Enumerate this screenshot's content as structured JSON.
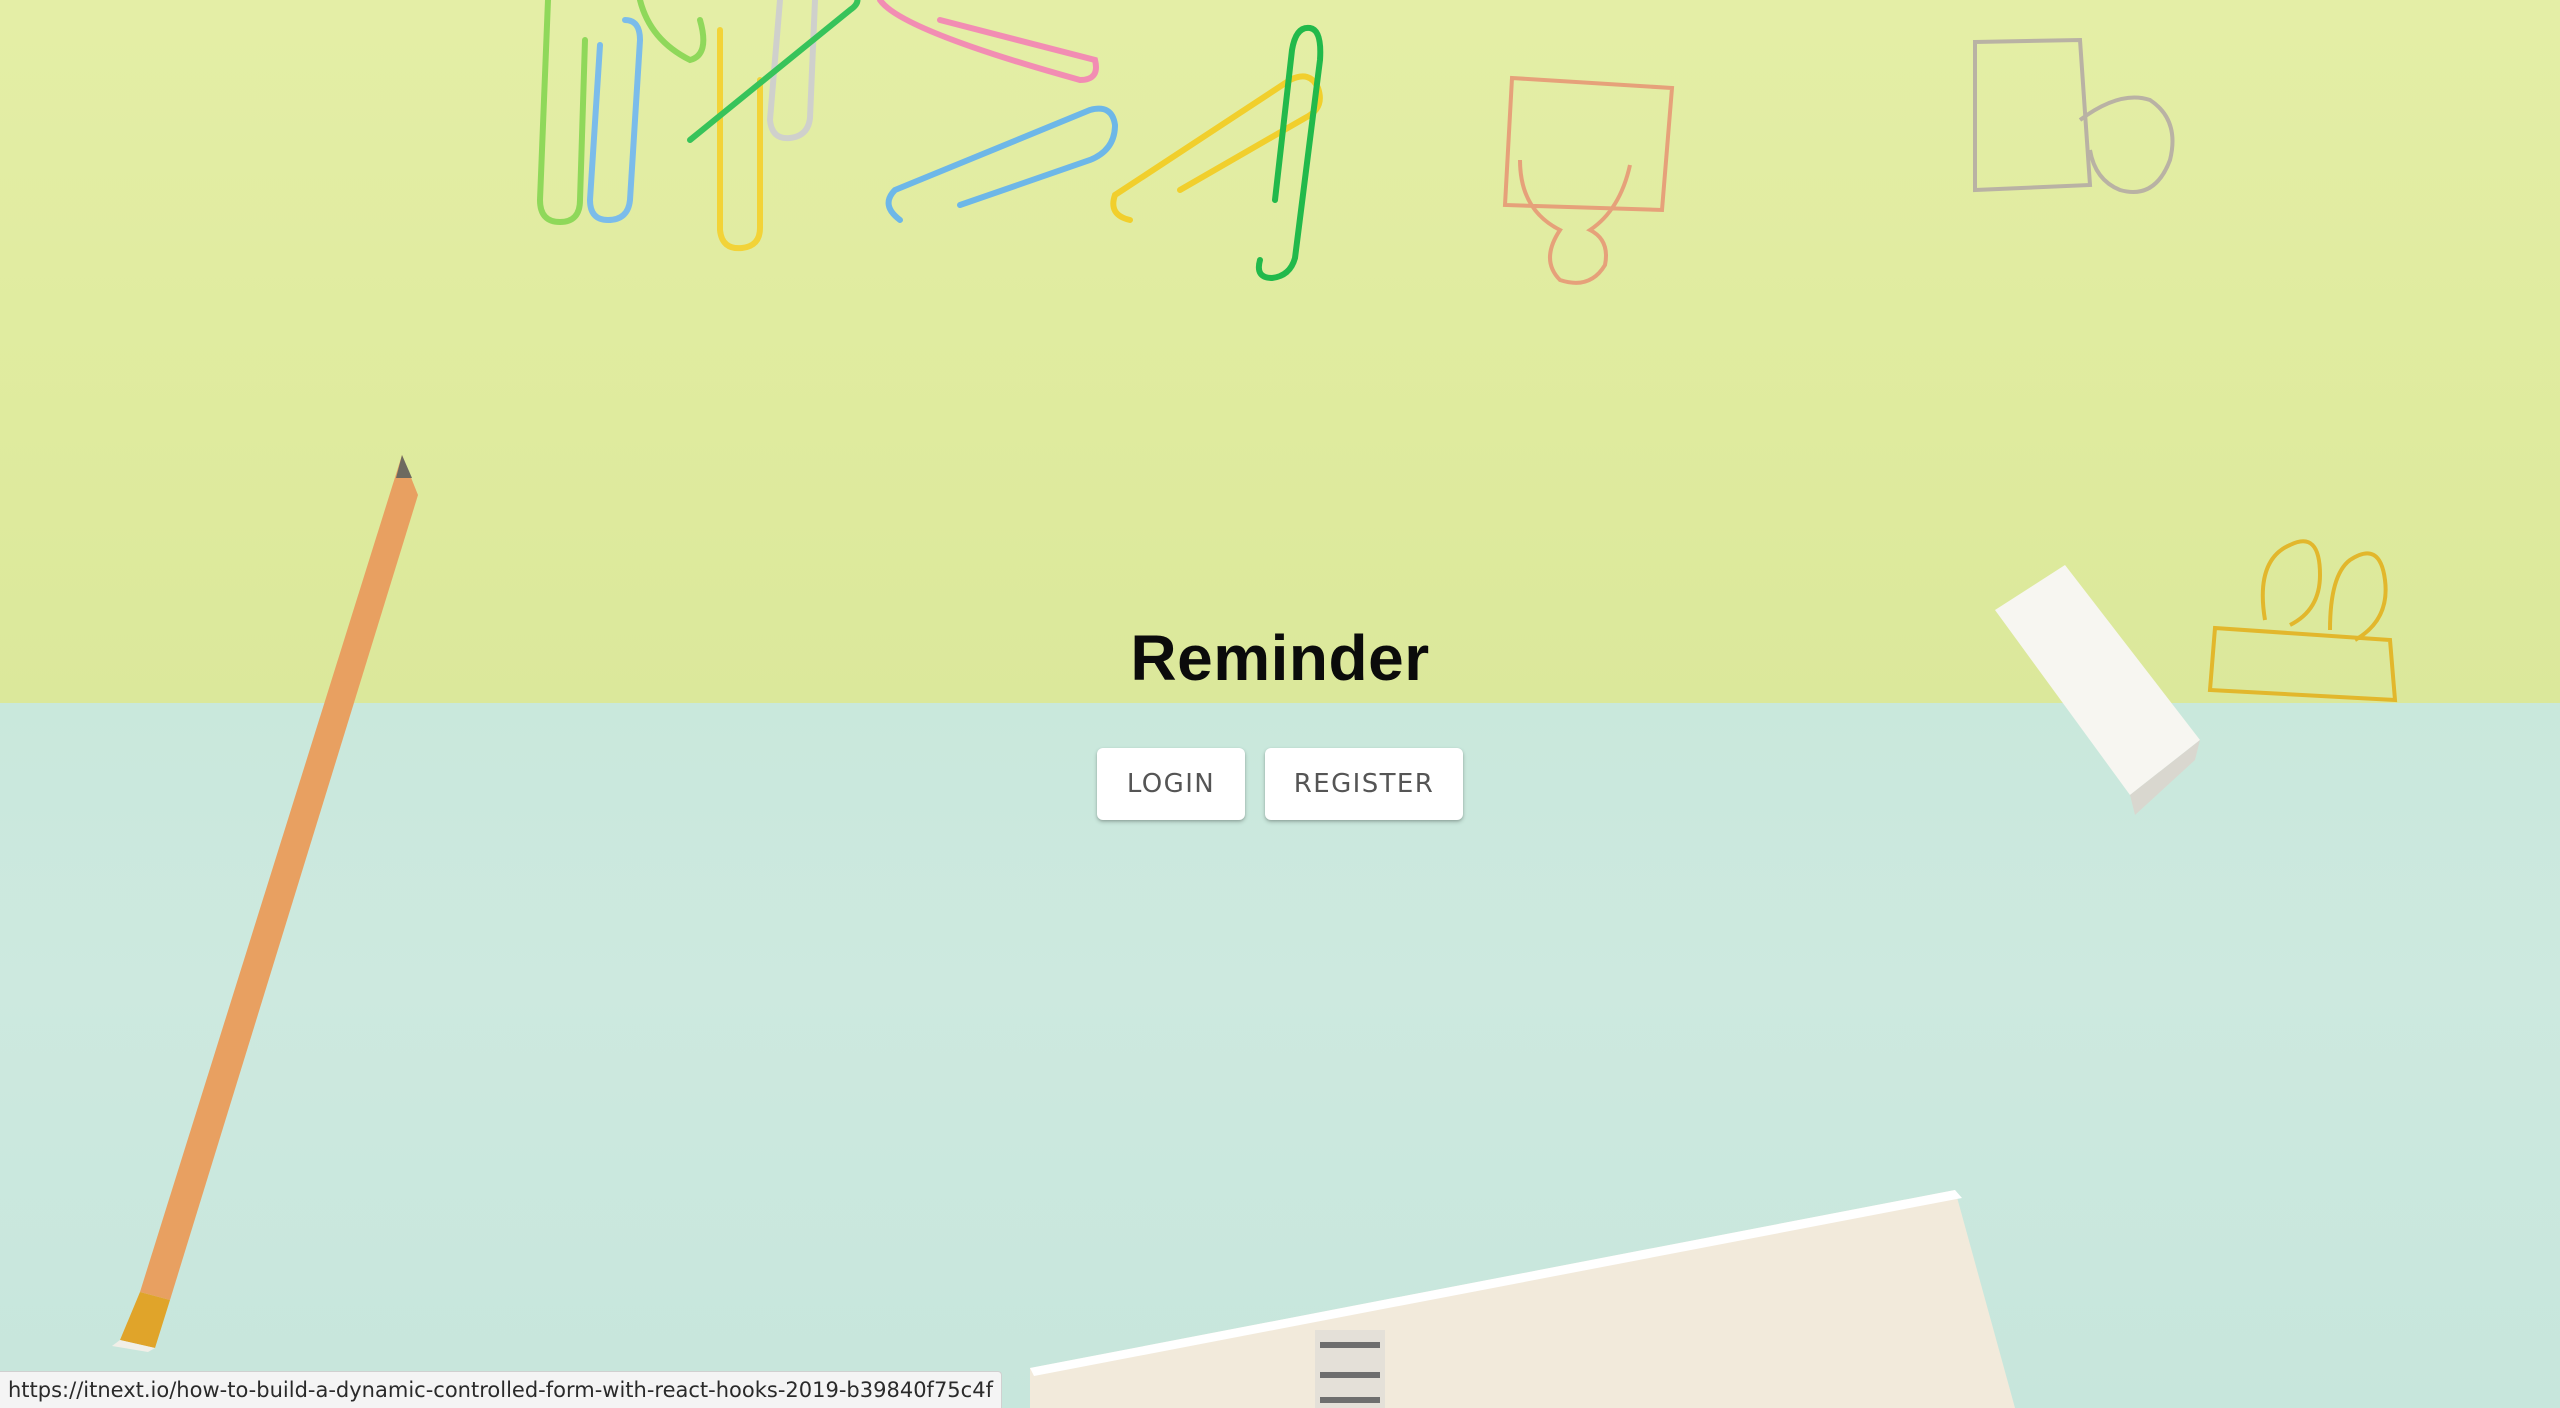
{
  "app": {
    "title": "Reminder"
  },
  "actions": {
    "login_label": "LOGIN",
    "register_label": "REGISTER"
  },
  "status_bar": {
    "url": "https://itnext.io/how-to-build-a-dynamic-controlled-form-with-react-hooks-2019-b39840f75c4f"
  },
  "colors": {
    "background_top": "#dfeb9e",
    "background_bottom": "#c9e8dc",
    "title_text": "#0b0b0b",
    "button_bg": "#ffffff",
    "button_text": "#555555"
  },
  "background_objects": [
    "paper-clips",
    "binder-clips",
    "pencil",
    "eraser",
    "notebook"
  ]
}
